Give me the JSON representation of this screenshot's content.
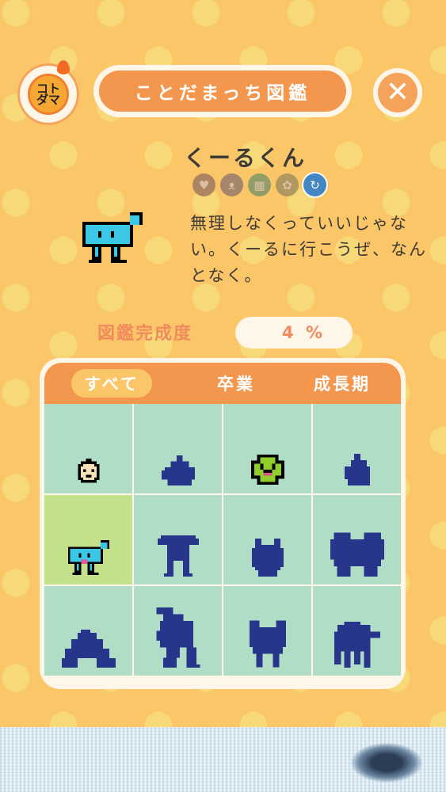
{
  "header": {
    "logo_text": "コト\nダマ",
    "title": "ことだまっち図鑑",
    "close_icon": "close-icon"
  },
  "character": {
    "name": "くーるくん",
    "badges": [
      {
        "icon": "heart-icon",
        "glyph": "♥",
        "active": false
      },
      {
        "icon": "cat-face-icon",
        "glyph": "ᴥ",
        "active": false
      },
      {
        "icon": "checker-icon",
        "glyph": "▦",
        "active": false
      },
      {
        "icon": "flower-icon",
        "glyph": "✿",
        "active": false
      },
      {
        "icon": "swirl-icon",
        "glyph": "↻",
        "active": true
      }
    ],
    "description": "無理しなくっていいじゃない。くーるに行こうぜ、なんとなく。"
  },
  "completion": {
    "label": "図鑑完成度",
    "value": "4 %"
  },
  "tabs": [
    {
      "label": "すべて",
      "selected": true
    },
    {
      "label": "卒業",
      "selected": false
    },
    {
      "label": "成長期",
      "selected": false
    }
  ],
  "colors": {
    "background": "#fbc667",
    "accent": "#f4974e",
    "cell": "#b0ddc6",
    "cell_selected": "#c3e08b",
    "silhouette": "#27368a"
  },
  "gallery": [
    {
      "id": "baby",
      "unlocked": true
    },
    {
      "id": "blob-a",
      "unlocked": false
    },
    {
      "id": "green-smile",
      "unlocked": true
    },
    {
      "id": "blob-b",
      "unlocked": false
    },
    {
      "id": "kuurukun",
      "unlocked": true,
      "selected": true
    },
    {
      "id": "round-legs",
      "unlocked": false
    },
    {
      "id": "small-bug",
      "unlocked": false
    },
    {
      "id": "big-cloud",
      "unlocked": false
    },
    {
      "id": "wave",
      "unlocked": false
    },
    {
      "id": "tall-spiky",
      "unlocked": false
    },
    {
      "id": "bear",
      "unlocked": false
    },
    {
      "id": "squid",
      "unlocked": false
    }
  ]
}
